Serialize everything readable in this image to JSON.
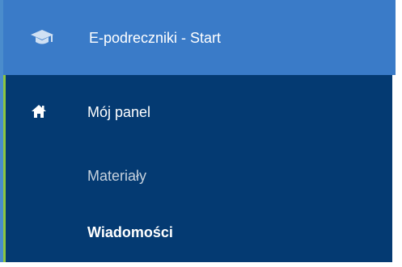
{
  "sidebar": {
    "header": {
      "label": "E-podreczniki - Start",
      "icon": "graduation-cap-icon"
    },
    "panel": {
      "home": {
        "label": "Mój panel",
        "icon": "home-icon"
      },
      "items": [
        {
          "label": "Materiały",
          "active": false
        },
        {
          "label": "Wiadomości",
          "active": true
        }
      ]
    }
  },
  "colors": {
    "header_bg": "#3a7bc8",
    "panel_bg": "#043a72",
    "accent_bar": "#8dc63f",
    "text_primary": "#ffffff",
    "text_muted": "#c6d1dd"
  }
}
